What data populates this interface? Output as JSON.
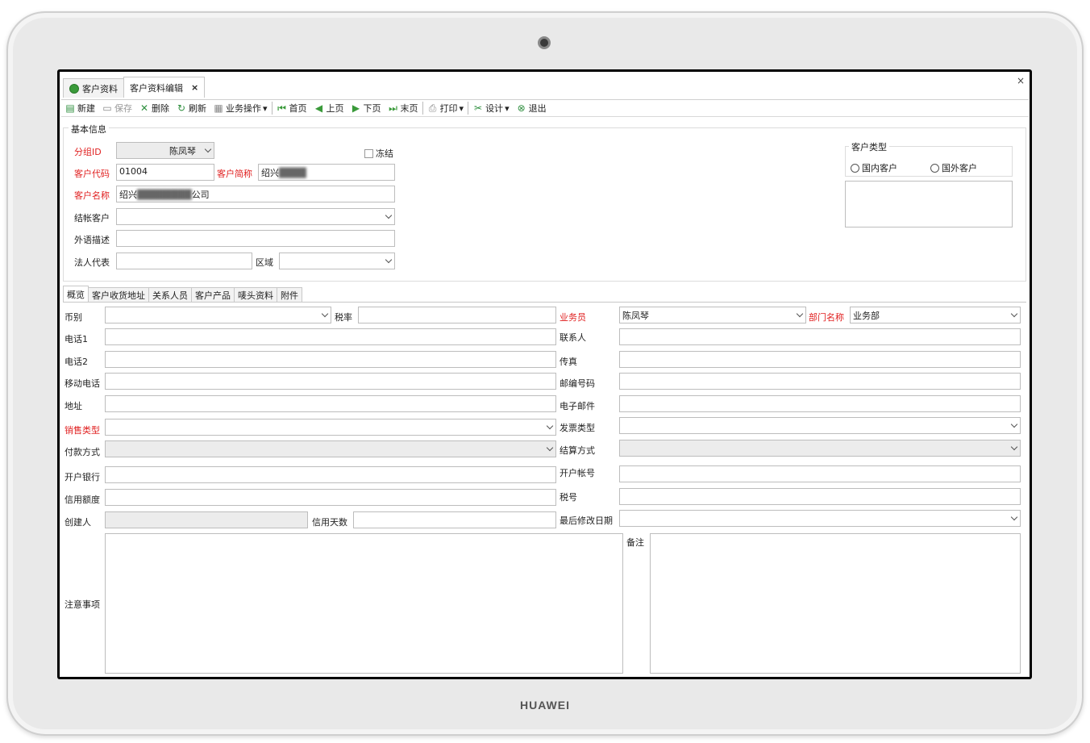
{
  "device": {
    "brand": "HUAWEI"
  },
  "tabs": [
    {
      "label": "客户资料"
    },
    {
      "label": "客户资料编辑"
    }
  ],
  "window": {
    "close": "×",
    "tab_close": "×"
  },
  "toolbar": {
    "new": "新建",
    "save": "保存",
    "delete": "删除",
    "refresh": "刷新",
    "business": "业务操作",
    "first": "首页",
    "prev": "上页",
    "next": "下页",
    "last": "末页",
    "print": "打印",
    "design": "设计",
    "exit": "退出"
  },
  "basic": {
    "legend": "基本信息",
    "group_id_label": "分组ID",
    "group_id_value": "陈凤琴",
    "freeze_label": "冻结",
    "code_label": "客户代码",
    "code_value": "01004",
    "short_label": "客户简称",
    "short_value": "绍兴",
    "name_label": "客户名称",
    "name_value": "绍兴",
    "name_suffix": "公司",
    "settle_label": "结帐客户",
    "settle_value": "",
    "foreign_label": "外语描述",
    "foreign_value": "",
    "legal_label": "法人代表",
    "legal_value": "",
    "area_label": "区域",
    "area_value": "",
    "type_legend": "客户类型",
    "domestic": "国内客户",
    "overseas": "国外客户"
  },
  "subtabs": [
    "概览",
    "客户收货地址",
    "关系人员",
    "客户产品",
    "唛头资料",
    "附件"
  ],
  "overview": {
    "currency": "币别",
    "tax_rate": "税率",
    "salesman": "业务员",
    "salesman_value": "陈凤琴",
    "dept": "部门名称",
    "dept_value": "业务部",
    "phone1": "电话1",
    "contact": "联系人",
    "phone2": "电话2",
    "fax": "传真",
    "mobile": "移动电话",
    "zip": "邮编号码",
    "address": "地址",
    "email": "电子邮件",
    "sales_type": "销售类型",
    "invoice_type": "发票类型",
    "pay_method": "付款方式",
    "settle_method": "结算方式",
    "bank": "开户银行",
    "account": "开户帐号",
    "credit_limit": "信用额度",
    "tax_no": "税号",
    "creator": "创建人",
    "credit_days": "信用天数",
    "last_modified": "最后修改日期",
    "notes": "注意事项",
    "remark": "备注"
  }
}
